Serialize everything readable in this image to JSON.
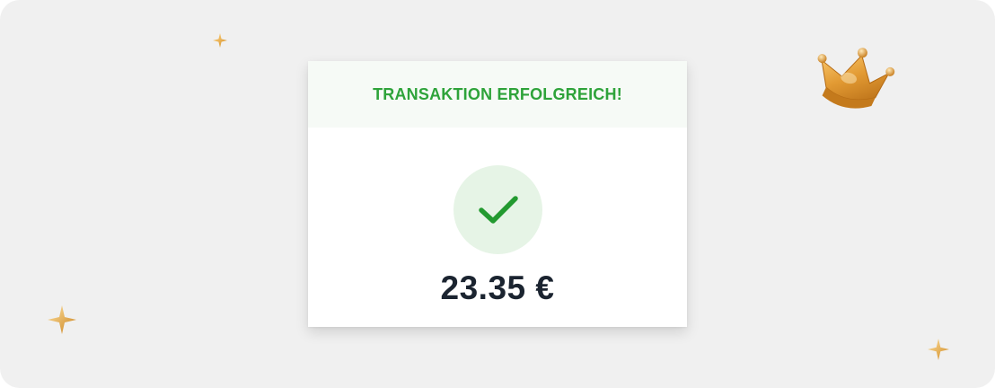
{
  "transaction": {
    "title": "TRANSAKTION ERFOLGREICH!",
    "amount": "23.35 €",
    "status_icon": "checkmark-icon"
  },
  "decorations": {
    "crown_icon": "crown-icon",
    "sparkle_icon": "sparkle-icon"
  },
  "colors": {
    "background": "#f0f0f0",
    "card": "#ffffff",
    "header_bg": "#f6faf6",
    "success_green": "#2ea33a",
    "check_circle_bg": "#e6f4e6",
    "amount_text": "#1b2430",
    "gold": "#e0a23c"
  }
}
